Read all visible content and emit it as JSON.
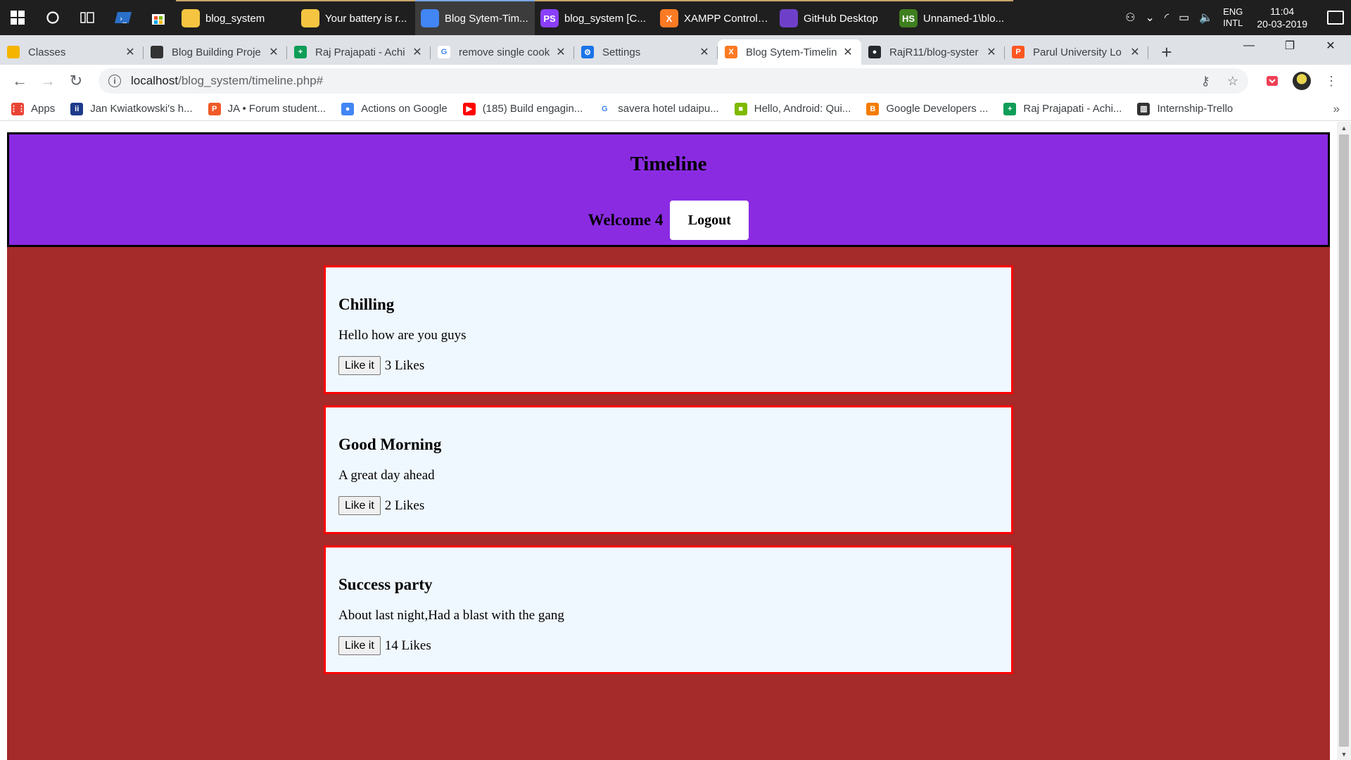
{
  "taskbar": {
    "apps": [
      {
        "label": "blog_system",
        "icon": "folder-icon",
        "color": "#f5c542",
        "glyph": "",
        "state": "running"
      },
      {
        "label": "Your battery is r...",
        "icon": "folder-icon",
        "color": "#f5c542",
        "glyph": "",
        "state": "running"
      },
      {
        "label": "Blog Sytem-Tim...",
        "icon": "chrome-icon",
        "color": "#4285f4",
        "glyph": "",
        "state": "active"
      },
      {
        "label": "blog_system [C...",
        "icon": "phpstorm-icon",
        "color": "#8a3ffc",
        "glyph": "PS",
        "state": "running"
      },
      {
        "label": "XAMPP Control ...",
        "icon": "xampp-icon",
        "color": "#fb7a24",
        "glyph": "X",
        "state": "running"
      },
      {
        "label": "GitHub Desktop",
        "icon": "github-desktop-icon",
        "color": "#6e40c9",
        "glyph": "",
        "state": "running"
      },
      {
        "label": "Unnamed-1\\blo...",
        "icon": "hype-icon",
        "color": "#3f7f1f",
        "glyph": "HS",
        "state": "running"
      }
    ],
    "tray": {
      "lang_top": "ENG",
      "lang_bottom": "INTL",
      "time": "11:04",
      "date": "20-03-2019"
    }
  },
  "browser": {
    "tabs": [
      {
        "label": "Classes",
        "fav_color": "#f4b400",
        "fav_glyph": "",
        "active": false
      },
      {
        "label": "Blog Building Proje",
        "fav_color": "#333333",
        "fav_glyph": "",
        "active": false
      },
      {
        "label": "Raj Prajapati - Achi",
        "fav_color": "#0f9d58",
        "fav_glyph": "+",
        "active": false
      },
      {
        "label": "remove single cook",
        "fav_color": "#ffffff",
        "fav_glyph": "G",
        "active": false
      },
      {
        "label": "Settings",
        "fav_color": "#1a73e8",
        "fav_glyph": "⚙",
        "active": false
      },
      {
        "label": "Blog Sytem-Timelin",
        "fav_color": "#fb7a24",
        "fav_glyph": "X",
        "active": true
      },
      {
        "label": "RajR11/blog-syster",
        "fav_color": "#24292e",
        "fav_glyph": "●",
        "active": false
      },
      {
        "label": "Parul University Lo",
        "fav_color": "#ff5722",
        "fav_glyph": "P",
        "active": false
      }
    ],
    "url_host": "localhost",
    "url_path": "/blog_system/timeline.php#",
    "bookmarks": [
      {
        "label": "Apps",
        "color": "#ea4335",
        "glyph": "⋮⋮"
      },
      {
        "label": "Jan Kwiatkowski's h...",
        "color": "#1d3a8a",
        "glyph": "ii"
      },
      {
        "label": "JA • Forum student...",
        "color": "#f05a28",
        "glyph": "P"
      },
      {
        "label": "Actions on Google",
        "color": "#4285f4",
        "glyph": "●"
      },
      {
        "label": "(185) Build engagin...",
        "color": "#ff0000",
        "glyph": "▶"
      },
      {
        "label": "savera hotel udaipu...",
        "color": "#ffffff",
        "glyph": "G"
      },
      {
        "label": "Hello, Android: Qui...",
        "color": "#7fba00",
        "glyph": "■"
      },
      {
        "label": "Google Developers ...",
        "color": "#f57c00",
        "glyph": "B"
      },
      {
        "label": "Raj Prajapati - Achi...",
        "color": "#0f9d58",
        "glyph": "+"
      },
      {
        "label": "Internship-Trello",
        "color": "#333333",
        "glyph": "▥"
      }
    ]
  },
  "site": {
    "title": "Timeline",
    "welcome": "Welcome 4",
    "logout_label": "Logout",
    "like_label": "Like it",
    "posts": [
      {
        "title": "Chilling",
        "body": "Hello how are you guys",
        "likes": "3 Likes"
      },
      {
        "title": "Good Morning",
        "body": "A great day ahead",
        "likes": "2 Likes"
      },
      {
        "title": "Success party",
        "body": "About last night,Had a blast with the gang",
        "likes": "14 Likes"
      }
    ],
    "colors": {
      "header_bg": "#8a2be2",
      "page_bg": "#a52a2a",
      "post_bg": "#f0f8ff",
      "post_border": "#ff0000"
    }
  }
}
